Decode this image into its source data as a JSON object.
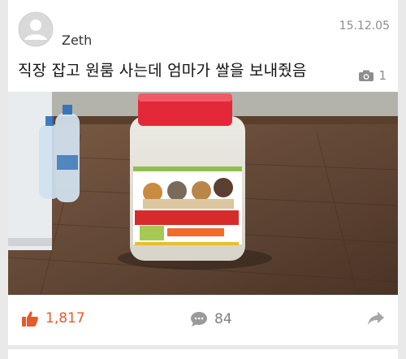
{
  "post": {
    "author": "Zeth",
    "date": "15.12.05",
    "title": "직장 잡고 원룸 사는데 엄마가 쌀을 보내줬음",
    "photo_count": "1",
    "likes": "1,817",
    "comments": "84"
  },
  "icons": {
    "avatar": "user-avatar-icon",
    "camera": "camera-icon",
    "like": "thumbs-up-icon",
    "comment": "speech-bubble-icon",
    "share": "share-arrow-icon"
  },
  "colors": {
    "like_accent": "#e45a2b",
    "muted": "#8d8d8d"
  }
}
